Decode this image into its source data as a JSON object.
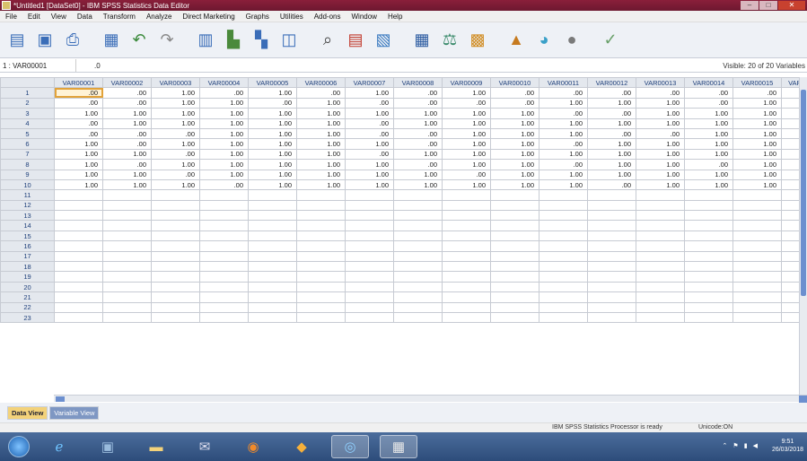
{
  "window": {
    "title": "*Untitled1 [DataSet0] - IBM SPSS Statistics Data Editor",
    "minimize": "–",
    "maximize": "□",
    "close": "✕"
  },
  "menu": [
    "File",
    "Edit",
    "View",
    "Data",
    "Transform",
    "Analyze",
    "Direct Marketing",
    "Graphs",
    "Utilities",
    "Add-ons",
    "Window",
    "Help"
  ],
  "toolbar_icons": [
    "open-icon",
    "save-icon",
    "print-icon",
    "dialog-recall-icon",
    "undo-icon",
    "redo-icon",
    "goto-case-icon",
    "goto-variable-icon",
    "variables-icon",
    "run-descriptives-icon",
    "find-icon",
    "insert-cases-icon",
    "insert-variable-icon",
    "split-file-icon",
    "weight-cases-icon",
    "select-cases-icon",
    "value-labels-icon",
    "use-sets-icon",
    "show-all-variables-icon",
    "spell-check-icon"
  ],
  "cell_editor": {
    "name": "1 : VAR00001",
    "value": ".0",
    "visible": "Visible: 20 of 20 Variables"
  },
  "grid": {
    "columns": [
      "VAR00001",
      "VAR00002",
      "VAR00003",
      "VAR00004",
      "VAR00005",
      "VAR00006",
      "VAR00007",
      "VAR00008",
      "VAR00009",
      "VAR00010",
      "VAR00011",
      "VAR00012",
      "VAR00013",
      "VAR00014",
      "VAR00015",
      "VAR"
    ],
    "row_numbers": [
      "1",
      "2",
      "3",
      "4",
      "5",
      "6",
      "7",
      "8",
      "9",
      "10",
      "11",
      "12",
      "13",
      "14",
      "15",
      "16",
      "17",
      "18",
      "19",
      "20",
      "21",
      "22",
      "23"
    ],
    "rows": [
      [
        ".00",
        ".00",
        "1.00",
        ".00",
        "1.00",
        ".00",
        "1.00",
        ".00",
        "1.00",
        ".00",
        ".00",
        ".00",
        ".00",
        ".00",
        ".00",
        ""
      ],
      [
        ".00",
        ".00",
        "1.00",
        "1.00",
        ".00",
        "1.00",
        ".00",
        ".00",
        ".00",
        ".00",
        "1.00",
        "1.00",
        "1.00",
        ".00",
        "1.00",
        ""
      ],
      [
        "1.00",
        "1.00",
        "1.00",
        "1.00",
        "1.00",
        "1.00",
        "1.00",
        "1.00",
        "1.00",
        "1.00",
        ".00",
        ".00",
        "1.00",
        "1.00",
        "1.00",
        ""
      ],
      [
        ".00",
        "1.00",
        "1.00",
        "1.00",
        "1.00",
        "1.00",
        ".00",
        "1.00",
        "1.00",
        "1.00",
        "1.00",
        "1.00",
        "1.00",
        "1.00",
        "1.00",
        ""
      ],
      [
        ".00",
        ".00",
        ".00",
        "1.00",
        "1.00",
        "1.00",
        ".00",
        ".00",
        "1.00",
        "1.00",
        "1.00",
        ".00",
        ".00",
        "1.00",
        "1.00",
        ""
      ],
      [
        "1.00",
        ".00",
        "1.00",
        "1.00",
        "1.00",
        "1.00",
        "1.00",
        ".00",
        "1.00",
        "1.00",
        ".00",
        "1.00",
        "1.00",
        "1.00",
        "1.00",
        ""
      ],
      [
        "1.00",
        "1.00",
        ".00",
        "1.00",
        "1.00",
        "1.00",
        ".00",
        "1.00",
        "1.00",
        "1.00",
        "1.00",
        "1.00",
        "1.00",
        "1.00",
        "1.00",
        ""
      ],
      [
        "1.00",
        ".00",
        "1.00",
        "1.00",
        "1.00",
        "1.00",
        "1.00",
        ".00",
        "1.00",
        "1.00",
        ".00",
        "1.00",
        "1.00",
        ".00",
        "1.00",
        ""
      ],
      [
        "1.00",
        "1.00",
        ".00",
        "1.00",
        "1.00",
        "1.00",
        "1.00",
        "1.00",
        ".00",
        "1.00",
        "1.00",
        "1.00",
        "1.00",
        "1.00",
        "1.00",
        ""
      ],
      [
        "1.00",
        "1.00",
        "1.00",
        ".00",
        "1.00",
        "1.00",
        "1.00",
        "1.00",
        "1.00",
        "1.00",
        "1.00",
        ".00",
        "1.00",
        "1.00",
        "1.00",
        ""
      ]
    ]
  },
  "tabs": {
    "data_view": "Data View",
    "variable_view": "Variable View"
  },
  "status": {
    "processor": "IBM SPSS Statistics Processor is ready",
    "unicode": "Unicode:ON"
  },
  "taskbar": {
    "apps": [
      "ie-icon",
      "explorer-icon",
      "folder-icon",
      "mail-icon",
      "firefox-icon",
      "paint-icon",
      "network-icon",
      "spss-icon"
    ],
    "time": "9:51",
    "date": "26/03/2018"
  }
}
